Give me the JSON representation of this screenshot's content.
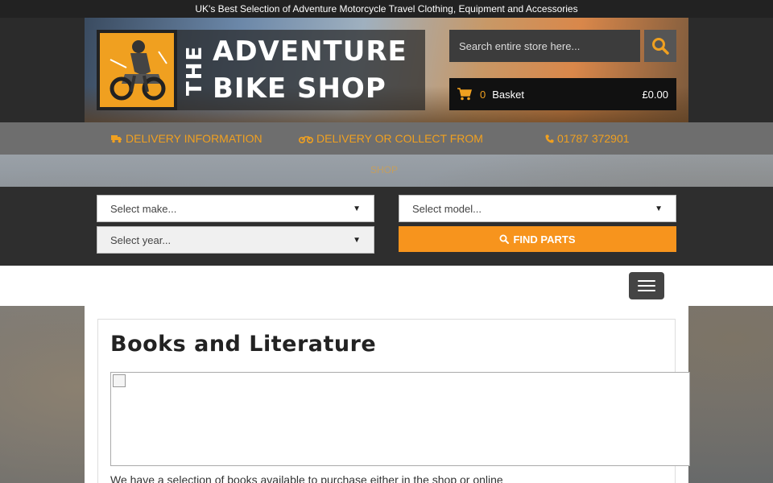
{
  "topbar": {
    "tagline": "UK's Best Selection of Adventure Motorcycle Travel Clothing, Equipment and Accessories"
  },
  "logo": {
    "the": "THE",
    "line1": "ADVENTURE",
    "line2": "BIKE SHOP"
  },
  "search": {
    "placeholder": "Search entire store here..."
  },
  "basket": {
    "count": "0",
    "label": "Basket",
    "total": "£0.00"
  },
  "infobar": {
    "delivery_info": "DELIVERY INFORMATION",
    "delivery_collect": "DELIVERY OR COLLECT FROM",
    "delivery_collect_cont": "SHOP",
    "phone": "01787 372901"
  },
  "parts_finder": {
    "make": "Select make...",
    "model": "Select model...",
    "year": "Select year...",
    "find_label": "FIND PARTS"
  },
  "content": {
    "title": "Books and Literature",
    "intro": "We have a selection of books available to purchase either in the shop or online"
  },
  "colors": {
    "accent": "#f7941d",
    "topbar": "#222222"
  }
}
